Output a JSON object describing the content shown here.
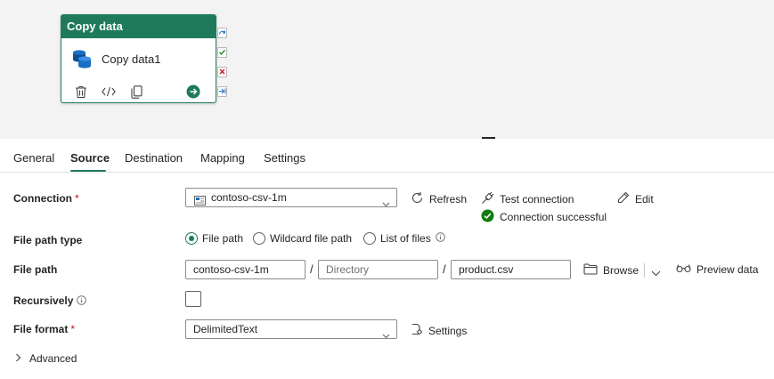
{
  "activity": {
    "header": "Copy data",
    "name": "Copy data1",
    "header_color": "#1f7a5c",
    "actions": [
      "delete-icon",
      "code-icon",
      "copy-icon",
      "go-icon"
    ],
    "ports": [
      "skip-port-icon",
      "success-port-icon",
      "fail-port-icon",
      "complete-port-icon"
    ]
  },
  "tabs": [
    {
      "label": "General",
      "active": false
    },
    {
      "label": "Source",
      "active": true
    },
    {
      "label": "Destination",
      "active": false
    },
    {
      "label": "Mapping",
      "active": false
    },
    {
      "label": "Settings",
      "active": false
    }
  ],
  "form": {
    "connection": {
      "label": "Connection",
      "required": "*",
      "value": "contoso-csv-1m",
      "refresh": "Refresh",
      "test": "Test connection",
      "status": "Connection successful",
      "edit": "Edit"
    },
    "file_path_type": {
      "label": "File path type",
      "options": [
        "File path",
        "Wildcard file path",
        "List of files"
      ],
      "selected": "File path"
    },
    "file_path": {
      "label": "File path",
      "container": "contoso-csv-1m",
      "directory_placeholder": "Directory",
      "file": "product.csv",
      "separator": "/",
      "browse": "Browse",
      "preview": "Preview data"
    },
    "recursively": {
      "label": "Recursively",
      "checked": false
    },
    "file_format": {
      "label": "File format",
      "required": "*",
      "value": "DelimitedText",
      "settings": "Settings"
    },
    "advanced": "Advanced"
  },
  "colors": {
    "accent": "#1f7a5c",
    "success": "#107c10",
    "required": "#c50f1f"
  }
}
